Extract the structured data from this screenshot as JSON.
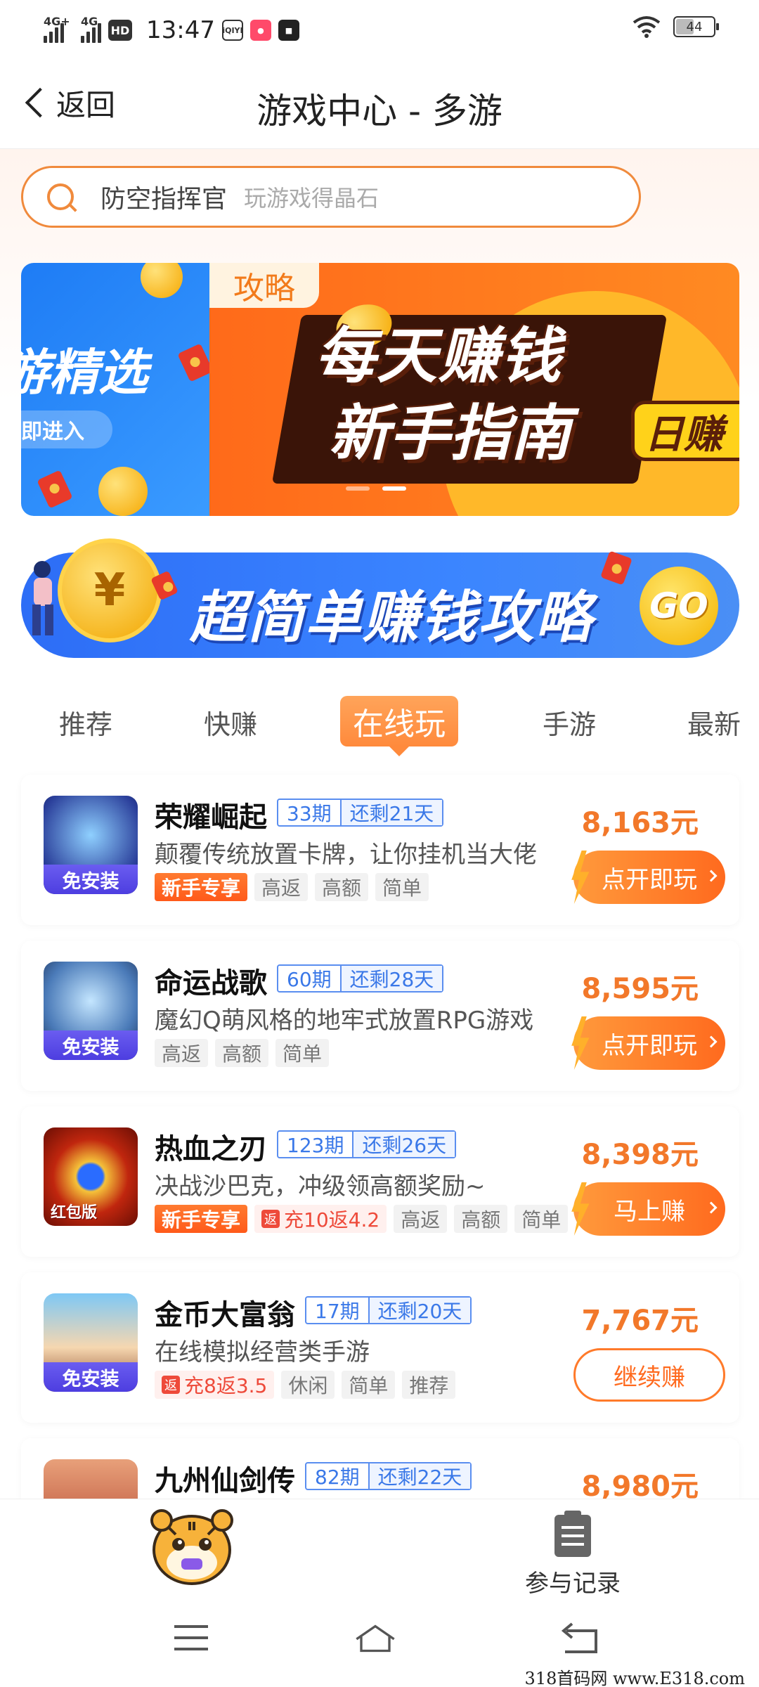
{
  "status_bar": {
    "net1": "4G+",
    "net2": "4G",
    "hd": "HD",
    "time": "13:47",
    "app_icons": [
      "iQIYI",
      "app",
      "app"
    ],
    "battery": "44"
  },
  "nav": {
    "back_label": "返回",
    "title": "游戏中心 - 多游"
  },
  "search": {
    "keyword": "防空指挥官",
    "placeholder": "玩游戏得晶石"
  },
  "carousel": {
    "left_title": "游精选",
    "left_sub": "即进入",
    "tag": "攻略",
    "line1": "每天赚钱",
    "line2": "新手指南",
    "pill": "日赚",
    "active_index": 1
  },
  "promo": {
    "coin_symbol": "¥",
    "text": "超简单赚钱攻略",
    "go": "GO"
  },
  "tabs": [
    "推荐",
    "快赚",
    "在线玩",
    "手游",
    "最新"
  ],
  "games": [
    {
      "name": "荣耀崛起",
      "period": "33期",
      "remaining": "还剩21天",
      "desc": "颠覆传统放置卡牌，让你挂机当大佬",
      "badge": "免安装",
      "tags": [
        {
          "type": "new",
          "text": "新手专享"
        },
        {
          "type": "plain",
          "text": "高返"
        },
        {
          "type": "plain",
          "text": "高额"
        },
        {
          "type": "plain",
          "text": "简单"
        }
      ],
      "reward": "8,163元",
      "button": "点开即玩",
      "button_style": "bolt"
    },
    {
      "name": "命运战歌",
      "period": "60期",
      "remaining": "还剩28天",
      "desc": "魔幻Q萌风格的地牢式放置RPG游戏",
      "badge": "免安装",
      "tags": [
        {
          "type": "plain",
          "text": "高返"
        },
        {
          "type": "plain",
          "text": "高额"
        },
        {
          "type": "plain",
          "text": "简单"
        }
      ],
      "reward": "8,595元",
      "button": "点开即玩",
      "button_style": "bolt"
    },
    {
      "name": "热血之刃",
      "period": "123期",
      "remaining": "还剩26天",
      "desc": "决战沙巴克，冲级领高额奖励~",
      "badge": "红包版",
      "tags": [
        {
          "type": "new",
          "text": "新手专享"
        },
        {
          "type": "ret",
          "text": "充10返4.2"
        },
        {
          "type": "plain",
          "text": "高返"
        },
        {
          "type": "plain",
          "text": "高额"
        },
        {
          "type": "plain",
          "text": "简单"
        }
      ],
      "reward": "8,398元",
      "button": "马上赚",
      "button_style": "bolt"
    },
    {
      "name": "金币大富翁",
      "period": "17期",
      "remaining": "还剩20天",
      "desc": "在线模拟经营类手游",
      "badge": "免安装",
      "tags": [
        {
          "type": "ret",
          "text": "充8返3.5"
        },
        {
          "type": "plain",
          "text": "休闲"
        },
        {
          "type": "plain",
          "text": "简单"
        },
        {
          "type": "plain",
          "text": "推荐"
        }
      ],
      "reward": "7,767元",
      "button": "继续赚",
      "button_style": "outline"
    },
    {
      "name": "九州仙剑传",
      "period": "82期",
      "remaining": "还剩22天",
      "desc": "",
      "badge": "",
      "tags": [],
      "reward": "8,980元",
      "button": "",
      "button_style": "none"
    }
  ],
  "ret_prefix": "返",
  "bottom": {
    "records_label": "参与记录"
  },
  "watermark": "318首码网 www.E318.com",
  "colors": {
    "accent": "#ff7a2a",
    "period_blue": "#3a78e8",
    "badge_purple": "#5a4ae8"
  }
}
